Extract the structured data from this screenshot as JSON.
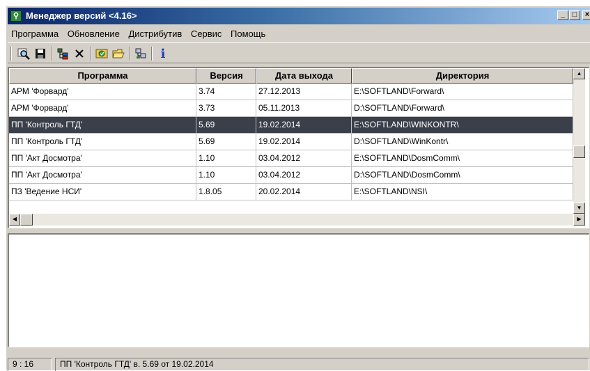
{
  "window": {
    "title": "Менеджер версий <4.16>",
    "min_label": "_",
    "max_label": "□",
    "close_label": "×"
  },
  "menu": {
    "items": [
      "Программа",
      "Обновление",
      "Дистрибутив",
      "Сервис",
      "Помощь"
    ]
  },
  "toolbar": {
    "icons": [
      "search-icon",
      "save-icon",
      "tree-icon",
      "delete-icon",
      "refresh-icon",
      "open-folder-icon",
      "network-icon",
      "info-icon"
    ],
    "info_label": "i"
  },
  "grid": {
    "columns": [
      "Программа",
      "Версия",
      "Дата выхода",
      "Директория"
    ],
    "rows": [
      {
        "program": "АРМ 'Форвард'",
        "version": "3.74",
        "date": "27.12.2013",
        "dir": "E:\\SOFTLAND\\Forward\\"
      },
      {
        "program": "АРМ 'Форвард'",
        "version": "3.73",
        "date": "05.11.2013",
        "dir": "D:\\SOFTLAND\\Forward\\"
      },
      {
        "program": "ПП 'Контроль ГТД'",
        "version": "5.69",
        "date": "19.02.2014",
        "dir": "E:\\SOFTLAND\\WINKONTR\\",
        "selected": true
      },
      {
        "program": "ПП 'Контроль ГТД'",
        "version": "5.69",
        "date": "19.02.2014",
        "dir": "D:\\SOFTLAND\\WinKontr\\"
      },
      {
        "program": "ПП 'Акт Досмотра'",
        "version": "1.10",
        "date": "03.04.2012",
        "dir": "E:\\SOFTLAND\\DosmComm\\"
      },
      {
        "program": "ПП 'Акт Досмотра'",
        "version": "1.10",
        "date": "03.04.2012",
        "dir": "D:\\SOFTLAND\\DosmComm\\"
      },
      {
        "program": "ПЗ 'Ведение НСИ'",
        "version": "1.8.05",
        "date": "20.02.2014",
        "dir": "E:\\SOFTLAND\\NSI\\"
      }
    ]
  },
  "scroll": {
    "up": "▲",
    "down": "▼",
    "left": "◀",
    "right": "▶"
  },
  "status": {
    "position": "9 : 16",
    "message": "ПП 'Контроль ГТД' в. 5.69 от 19.02.2014"
  },
  "colors": {
    "title_start": "#0a246a",
    "title_end": "#a6caf0",
    "face": "#d4d0c8",
    "selection": "#3a3f4a"
  }
}
